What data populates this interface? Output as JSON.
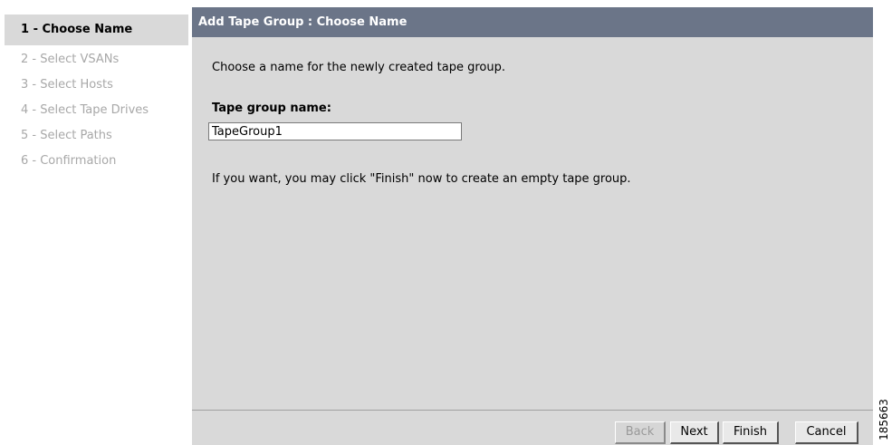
{
  "wizard": {
    "steps": [
      {
        "label": "1 - Choose Name",
        "active": true
      },
      {
        "label": "2 - Select VSANs",
        "active": false
      },
      {
        "label": "3 - Select Hosts",
        "active": false
      },
      {
        "label": "4 - Select Tape Drives",
        "active": false
      },
      {
        "label": "5 - Select Paths",
        "active": false
      },
      {
        "label": "6 - Confirmation",
        "active": false
      }
    ]
  },
  "panel": {
    "title": "Add Tape Group : Choose Name",
    "intro": "Choose a name for the newly created tape group.",
    "field_label": "Tape group name:",
    "field_value": "TapeGroup1",
    "hint": "If you want, you may click \"Finish\" now to create an empty tape group."
  },
  "buttons": {
    "back": "Back",
    "next": "Next",
    "finish": "Finish",
    "cancel": "Cancel"
  },
  "figure_id": "185663"
}
